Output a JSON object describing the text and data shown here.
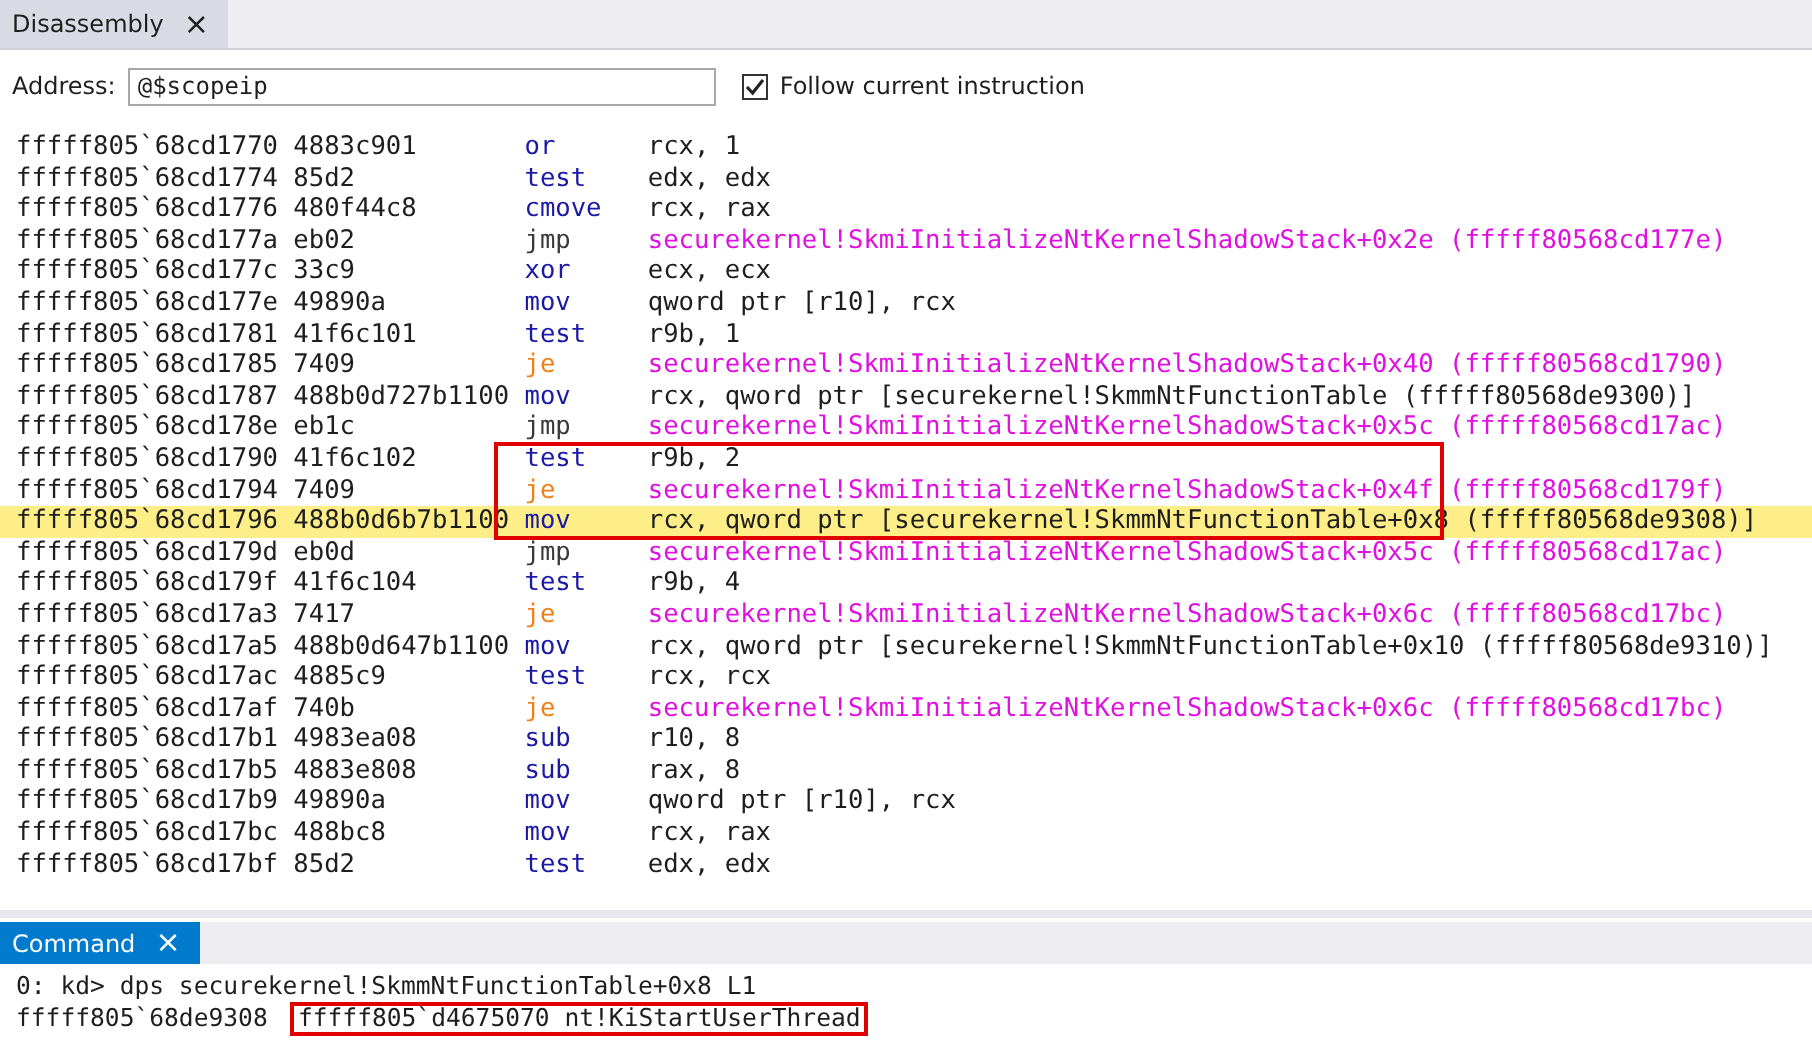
{
  "disassembly": {
    "tab": {
      "label": "Disassembly",
      "selected": true,
      "close": "×"
    },
    "toolbar": {
      "address_label": "Address:",
      "address_value": "@$scopeip",
      "follow_current_instruction": {
        "label": "Follow current instruction",
        "checked": true
      }
    },
    "rows": [
      {
        "address": "fffff805`68cd1770",
        "bytes": "4883c901",
        "mnemonic": "or",
        "operand": "rcx, 1",
        "kind": "plain",
        "current": false,
        "annotated": false
      },
      {
        "address": "fffff805`68cd1774",
        "bytes": "85d2",
        "mnemonic": "test",
        "operand": "edx, edx",
        "kind": "plain",
        "current": false,
        "annotated": false
      },
      {
        "address": "fffff805`68cd1776",
        "bytes": "480f44c8",
        "mnemonic": "cmove",
        "operand": "rcx, rax",
        "kind": "plain",
        "current": false,
        "annotated": false
      },
      {
        "address": "fffff805`68cd177a",
        "bytes": "eb02",
        "mnemonic": "jmp",
        "operand": "securekernel!SkmiInitializeNtKernelShadowStack+0x2e (fffff80568cd177e)",
        "kind": "jump",
        "current": false,
        "annotated": false
      },
      {
        "address": "fffff805`68cd177c",
        "bytes": "33c9",
        "mnemonic": "xor",
        "operand": "ecx, ecx",
        "kind": "plain",
        "current": false,
        "annotated": false
      },
      {
        "address": "fffff805`68cd177e",
        "bytes": "49890a",
        "mnemonic": "mov",
        "operand": "qword ptr [r10], rcx",
        "kind": "plain",
        "current": false,
        "annotated": false
      },
      {
        "address": "fffff805`68cd1781",
        "bytes": "41f6c101",
        "mnemonic": "test",
        "operand": "r9b, 1",
        "kind": "plain",
        "current": false,
        "annotated": false
      },
      {
        "address": "fffff805`68cd1785",
        "bytes": "7409",
        "mnemonic": "je",
        "operand": "securekernel!SkmiInitializeNtKernelShadowStack+0x40 (fffff80568cd1790)",
        "kind": "cond_jump",
        "current": false,
        "annotated": false
      },
      {
        "address": "fffff805`68cd1787",
        "bytes": "488b0d727b1100",
        "mnemonic": "mov",
        "operand": "rcx, qword ptr [securekernel!SkmmNtFunctionTable (fffff80568de9300)]",
        "kind": "plain",
        "current": false,
        "annotated": false
      },
      {
        "address": "fffff805`68cd178e",
        "bytes": "eb1c",
        "mnemonic": "jmp",
        "operand": "securekernel!SkmiInitializeNtKernelShadowStack+0x5c (fffff80568cd17ac)",
        "kind": "jump",
        "current": false,
        "annotated": false
      },
      {
        "address": "fffff805`68cd1790",
        "bytes": "41f6c102",
        "mnemonic": "test",
        "operand": "r9b, 2",
        "kind": "plain",
        "current": false,
        "annotated": true
      },
      {
        "address": "fffff805`68cd1794",
        "bytes": "7409",
        "mnemonic": "je",
        "operand": "securekernel!SkmiInitializeNtKernelShadowStack+0x4f (fffff80568cd179f)",
        "kind": "cond_jump",
        "current": false,
        "annotated": true
      },
      {
        "address": "fffff805`68cd1796",
        "bytes": "488b0d6b7b1100",
        "mnemonic": "mov",
        "operand": "rcx, qword ptr [securekernel!SkmmNtFunctionTable+0x8",
        "operand_tail": "(fffff80568de9308)]",
        "kind": "plain",
        "current": true,
        "annotated": true
      },
      {
        "address": "fffff805`68cd179d",
        "bytes": "eb0d",
        "mnemonic": "jmp",
        "operand": "securekernel!SkmiInitializeNtKernelShadowStack+0x5c (fffff80568cd17ac)",
        "kind": "jump",
        "current": false,
        "annotated": false
      },
      {
        "address": "fffff805`68cd179f",
        "bytes": "41f6c104",
        "mnemonic": "test",
        "operand": "r9b, 4",
        "kind": "plain",
        "current": false,
        "annotated": false
      },
      {
        "address": "fffff805`68cd17a3",
        "bytes": "7417",
        "mnemonic": "je",
        "operand": "securekernel!SkmiInitializeNtKernelShadowStack+0x6c (fffff80568cd17bc)",
        "kind": "cond_jump",
        "current": false,
        "annotated": false
      },
      {
        "address": "fffff805`68cd17a5",
        "bytes": "488b0d647b1100",
        "mnemonic": "mov",
        "operand": "rcx, qword ptr [securekernel!SkmmNtFunctionTable+0x10 (fffff80568de9310)]",
        "kind": "plain",
        "current": false,
        "annotated": false
      },
      {
        "address": "fffff805`68cd17ac",
        "bytes": "4885c9",
        "mnemonic": "test",
        "operand": "rcx, rcx",
        "kind": "plain",
        "current": false,
        "annotated": false
      },
      {
        "address": "fffff805`68cd17af",
        "bytes": "740b",
        "mnemonic": "je",
        "operand": "securekernel!SkmiInitializeNtKernelShadowStack+0x6c (fffff80568cd17bc)",
        "kind": "cond_jump",
        "current": false,
        "annotated": false
      },
      {
        "address": "fffff805`68cd17b1",
        "bytes": "4983ea08",
        "mnemonic": "sub",
        "operand": "r10, 8",
        "kind": "plain",
        "current": false,
        "annotated": false
      },
      {
        "address": "fffff805`68cd17b5",
        "bytes": "4883e808",
        "mnemonic": "sub",
        "operand": "rax, 8",
        "kind": "plain",
        "current": false,
        "annotated": false
      },
      {
        "address": "fffff805`68cd17b9",
        "bytes": "49890a",
        "mnemonic": "mov",
        "operand": "qword ptr [r10], rcx",
        "kind": "plain",
        "current": false,
        "annotated": false
      },
      {
        "address": "fffff805`68cd17bc",
        "bytes": "488bc8",
        "mnemonic": "mov",
        "operand": "rcx, rax",
        "kind": "plain",
        "current": false,
        "annotated": false
      },
      {
        "address": "fffff805`68cd17bf",
        "bytes": "85d2",
        "mnemonic": "test",
        "operand": "edx, edx",
        "kind": "plain",
        "current": false,
        "annotated": false
      }
    ]
  },
  "command": {
    "tab": {
      "label": "Command",
      "selected": true,
      "close": "×"
    },
    "lines": [
      {
        "text": "0: kd> dps securekernel!SkmmNtFunctionTable+0x8 L1"
      },
      {
        "text": "fffff805`68de9308",
        "highlighted_text": "fffff805`d4675070 nt!KiStartUserThread"
      }
    ]
  }
}
